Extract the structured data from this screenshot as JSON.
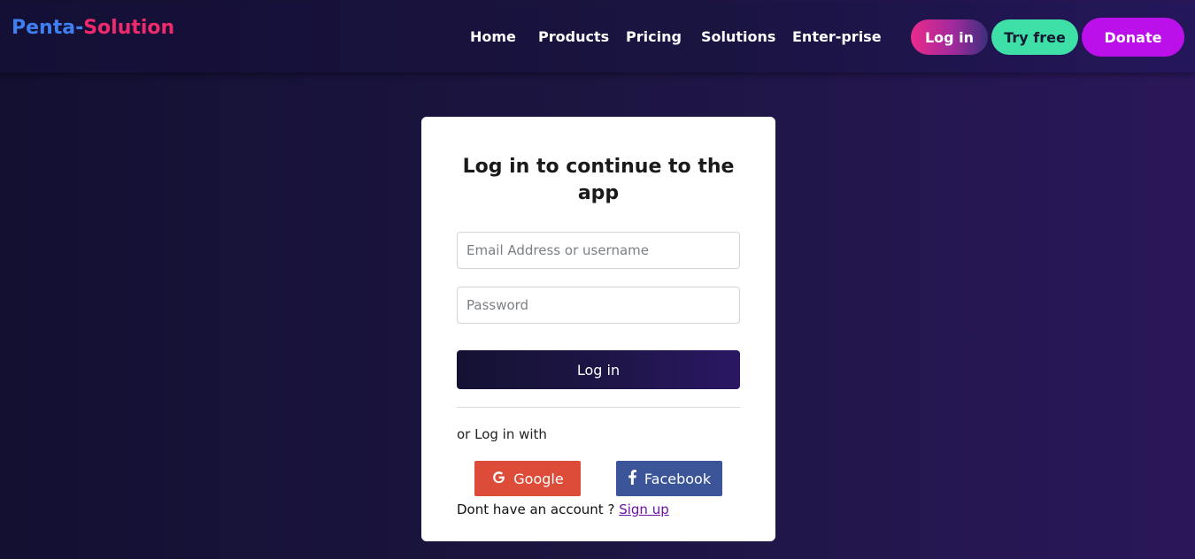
{
  "brand": {
    "part1": "Penta-",
    "part2": "Solution",
    "color1": "#3f7ff0",
    "color2": "#ee2a6c"
  },
  "nav": {
    "items": [
      {
        "label": "Home"
      },
      {
        "label": "Products"
      },
      {
        "label": "Pricing"
      },
      {
        "label": "Solutions"
      },
      {
        "label": "Enter-prise"
      }
    ]
  },
  "header_buttons": {
    "login": "Log in",
    "try_free": "Try free",
    "donate": "Donate"
  },
  "login_card": {
    "title": "Log in to continue to the app",
    "email_placeholder": "Email Address or username",
    "email_value": "",
    "password_placeholder": "Password",
    "password_value": "",
    "submit_label": "Log in",
    "alt_text": "or Log in with",
    "google_label": "Google",
    "google_icon": "google-g-icon",
    "facebook_label": "Facebook",
    "facebook_icon": "facebook-f-icon",
    "signup_prompt": "Dont have an account ?",
    "signup_link": "Sign up"
  },
  "colors": {
    "try_free": "#3fe0a7",
    "donate": "#bb10ea",
    "google": "#dd4b39",
    "facebook": "#3b5598",
    "link": "#6a12a9"
  }
}
